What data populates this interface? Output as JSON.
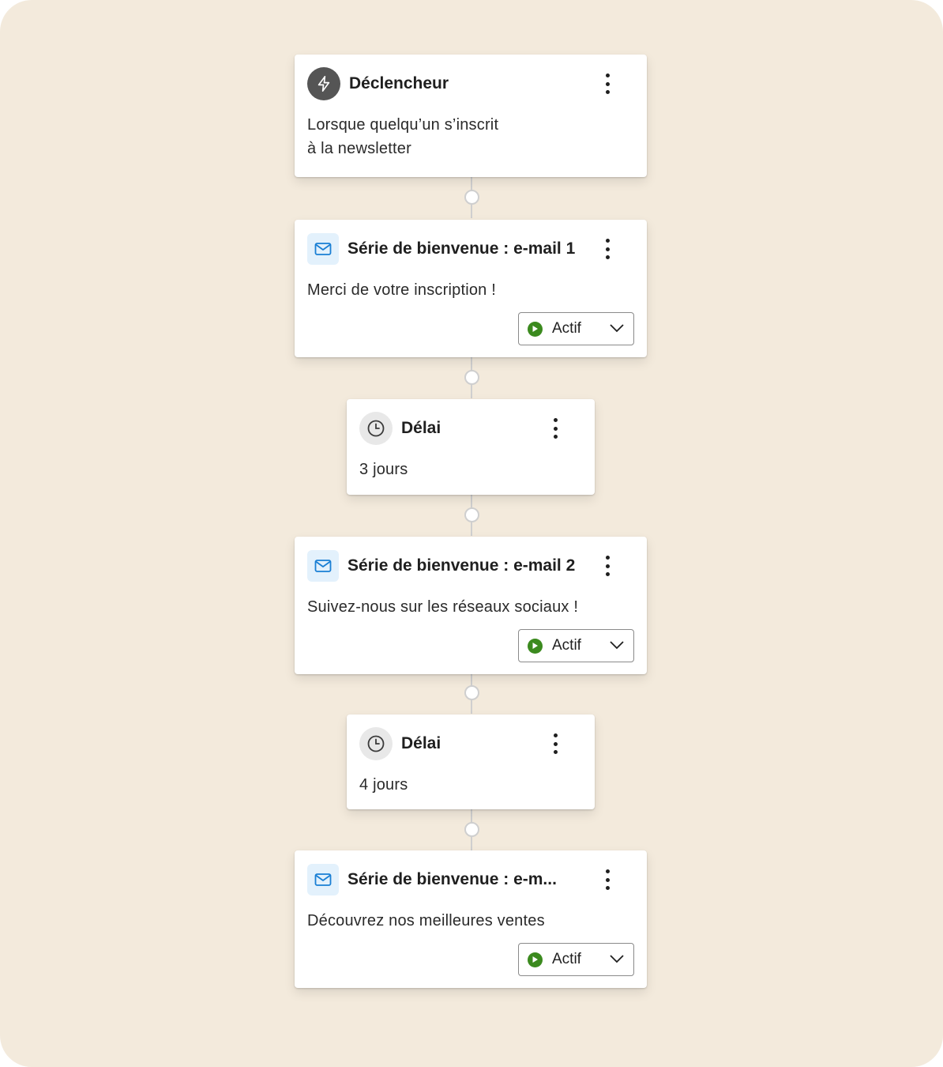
{
  "steps": [
    {
      "kind": "trigger",
      "icon": "lightning-icon",
      "title": "Déclencheur",
      "desc_line1": "Lorsque quelqu’un s’inscrit",
      "desc_line2": "à la newsletter"
    },
    {
      "kind": "email",
      "icon": "mail-icon",
      "title": "Série de bienvenue : e-mail 1",
      "desc": "Merci de votre inscription !",
      "status": "Actif"
    },
    {
      "kind": "delay",
      "icon": "clock-icon",
      "title": "Délai",
      "desc": "3 jours"
    },
    {
      "kind": "email",
      "icon": "mail-icon",
      "title": "Série de bienvenue : e-mail 2",
      "desc": "Suivez-nous sur les réseaux sociaux !",
      "status": "Actif"
    },
    {
      "kind": "delay",
      "icon": "clock-icon",
      "title": "Délai",
      "desc": "4 jours"
    },
    {
      "kind": "email",
      "icon": "mail-icon",
      "title": "Série de bienvenue : e-m...",
      "desc": "Découvrez nos meilleures ventes",
      "status": "Actif"
    }
  ],
  "colors": {
    "background": "#f3eadc",
    "card": "#ffffff",
    "status_active": "#3b8a1e",
    "mail_icon": "#1a7fd4",
    "connector": "#cfcfcf"
  }
}
